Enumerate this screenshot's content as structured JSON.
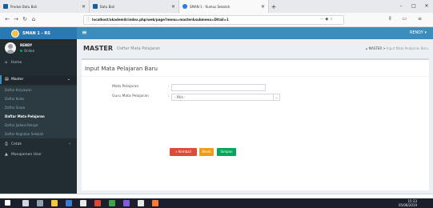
{
  "browser": {
    "tabs": [
      {
        "label": "Produk Batu Bali",
        "active": false
      },
      {
        "label": "Batu Bali",
        "active": false
      },
      {
        "label": "SMAN 1 - Rumus Sekolah",
        "active": true
      }
    ],
    "url": "localhost/akademik/index.php/web/page?menu=master&submenu=Ditail=1",
    "new_tab": "+",
    "window_controls": [
      "–",
      "□",
      "✕"
    ]
  },
  "app": {
    "brand": "SMAN 1 - RS",
    "user_menu": "RENDY ▾",
    "colors": {
      "header": "#3c8dbc",
      "brand": "#2c78b3",
      "sidebar": "#222d32",
      "content_bg": "#ecf0f5",
      "btn_back": "#dd4b39",
      "btn_reset": "#f39c12",
      "btn_save": "#00a65a"
    }
  },
  "sidebar": {
    "user": {
      "name": "RENDY",
      "status": "Online"
    },
    "items": [
      {
        "icon": "home-icon",
        "label": "Home"
      },
      {
        "icon": "database-icon",
        "label": "Master",
        "open": true
      },
      {
        "icon": "print-icon",
        "label": "Cetak"
      },
      {
        "icon": "user-icon",
        "label": "Manajemen User"
      }
    ],
    "submenu": [
      {
        "label": "Daftar Karyawan",
        "active": false
      },
      {
        "label": "Daftar Kelas",
        "active": false
      },
      {
        "label": "Daftar Siswa",
        "active": false
      },
      {
        "label": "Daftar Mata Pelajaran",
        "active": true
      },
      {
        "label": "Daftar Jadwal Belajar",
        "active": false
      },
      {
        "label": "Daftar Kegiatan Sekolah",
        "active": false
      }
    ]
  },
  "content": {
    "title": "MASTER",
    "subtitle": "Daftar Mata Pelajaran",
    "breadcrumb": {
      "root": "MASTER",
      "current": "Input Mata Pelajaran Baru"
    },
    "form_title": "Input Mata Pelajaran Baru",
    "fields": {
      "mapel_label": "Mata Pelajaran",
      "mapel_value": "",
      "guru_label": "Guru Mata Pelajaran",
      "guru_value": "- Pilih -"
    },
    "buttons": {
      "back": "« Kembali",
      "reset": "Reset",
      "save": "Simpan"
    }
  },
  "tray": {
    "time": "15:33",
    "date": "05/08/2019"
  }
}
